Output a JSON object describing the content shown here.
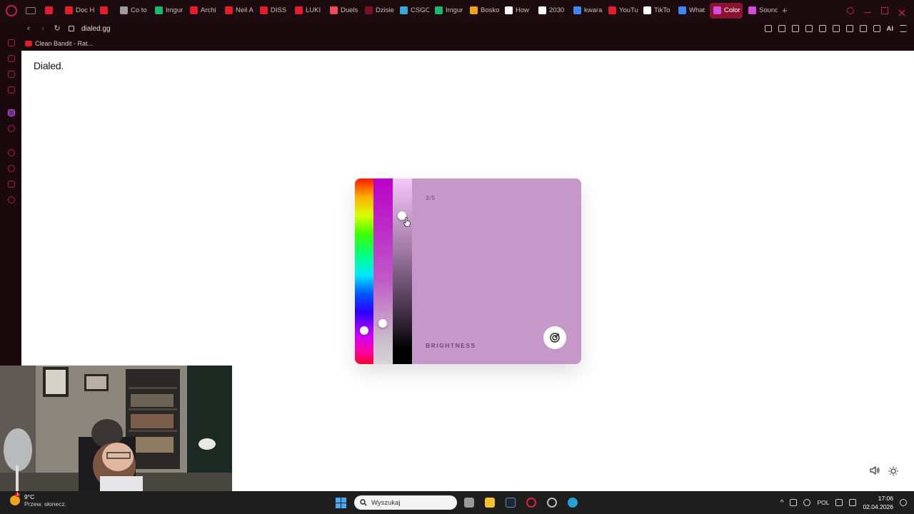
{
  "browser": {
    "tabs": [
      {
        "label": "",
        "favicon_color": "#e21e2d"
      },
      {
        "label": "Doc H",
        "favicon_color": "#e21e2d"
      },
      {
        "label": "",
        "favicon_color": "#e21e2d"
      },
      {
        "label": "Co to",
        "favicon_color": "#9c9ca0"
      },
      {
        "label": "Imgur",
        "favicon_color": "#1bb76e"
      },
      {
        "label": "Archi",
        "favicon_color": "#e21e2d"
      },
      {
        "label": "Neil A",
        "favicon_color": "#e21e2d"
      },
      {
        "label": "DISS",
        "favicon_color": "#e21e2d"
      },
      {
        "label": "LUKI",
        "favicon_color": "#e21e2d"
      },
      {
        "label": "Duels",
        "favicon_color": "#ef4a5c"
      },
      {
        "label": "Dzisie",
        "favicon_color": "#7a1020"
      },
      {
        "label": "CSGO",
        "favicon_color": "#3aa7d8"
      },
      {
        "label": "Imgur",
        "favicon_color": "#1bb76e"
      },
      {
        "label": "Bosko",
        "favicon_color": "#f0a21c"
      },
      {
        "label": "How",
        "favicon_color": "#ffffff"
      },
      {
        "label": "2030",
        "favicon_color": "#ffffff"
      },
      {
        "label": "kwara",
        "favicon_color": "#4285f4"
      },
      {
        "label": "YouTu",
        "favicon_color": "#e21e2d"
      },
      {
        "label": "TikTo",
        "favicon_color": "#ffffff"
      },
      {
        "label": "What",
        "favicon_color": "#4285f4"
      },
      {
        "label": "Color G",
        "favicon_color": "#d34cd8",
        "active": true
      },
      {
        "label": "Sound",
        "favicon_color": "#d34cd8"
      }
    ],
    "url": "dialed.gg",
    "bookmark_label": "Clean Bandit - Rat...",
    "ai_label": "AI"
  },
  "page": {
    "logo": "Dialed.",
    "card": {
      "step": "3/5",
      "mode_label": "BRIGHTNESS",
      "current_color": "#c598c9",
      "hue_fraction": 0.82,
      "saturation_fraction": 0.78,
      "brightness_fraction": 0.2
    }
  },
  "taskbar": {
    "weather_temp": "9°C",
    "weather_desc": "Przew. słonecz.",
    "search_placeholder": "Wyszukaj",
    "language": "POL",
    "time": "17:06",
    "date": "02.04.2026",
    "weather_badge": "1"
  }
}
